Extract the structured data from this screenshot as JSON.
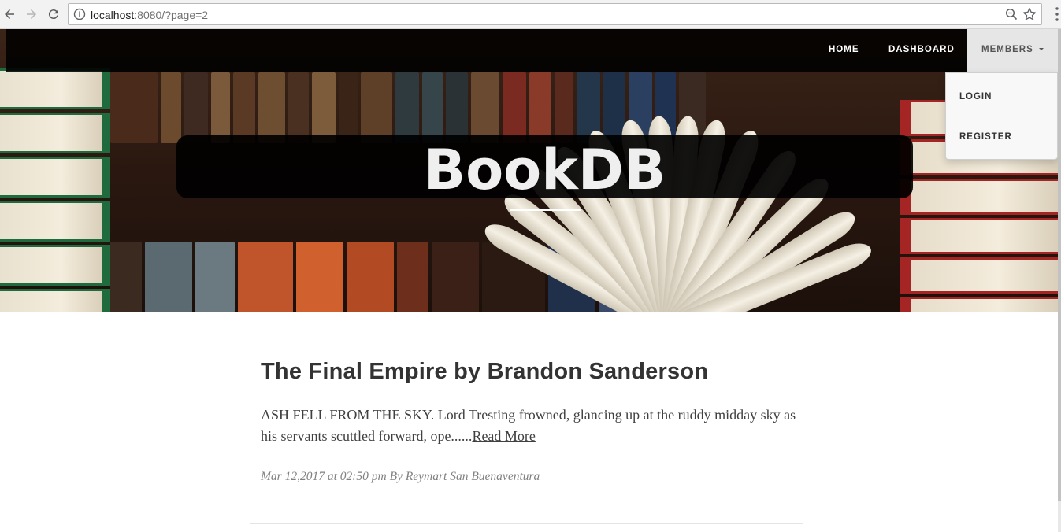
{
  "browser": {
    "url_host": "localhost",
    "url_rest": ":8080/?page=2"
  },
  "navbar": {
    "home": "HOME",
    "dashboard": "DASHBOARD",
    "members": "MEMBERS"
  },
  "dropdown": {
    "items": [
      "LOGIN",
      "REGISTER"
    ]
  },
  "hero": {
    "title": "BookDB"
  },
  "post": {
    "title": "The Final Empire by Brandon Sanderson",
    "excerpt": "ASH FELL FROM THE SKY. Lord Tresting frowned, glancing up at the ruddy midday sky as his servants scuttled forward, ope......",
    "read_more": "Read More",
    "meta": "Mar 12,2017 at 02:50 pm By Reymart San Buenaventura"
  },
  "colors": {
    "navbar_bg": "#000000",
    "members_active_bg": "#e6e6e6",
    "shelf_green": "#1f6b3d",
    "shelf_red": "#a52424"
  }
}
